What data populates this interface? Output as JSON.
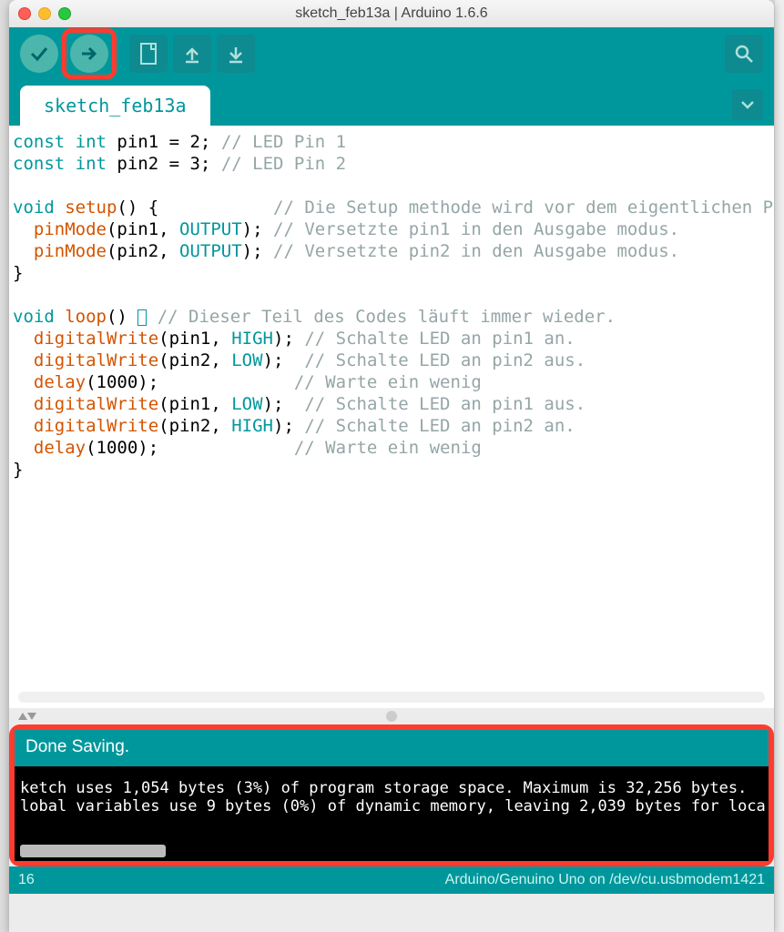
{
  "window": {
    "title": "sketch_feb13a | Arduino 1.6.6"
  },
  "toolbar": {
    "verify_icon": "checkmark-icon",
    "upload_icon": "arrow-right-icon",
    "new_icon": "file-icon",
    "open_icon": "arrow-up-icon",
    "save_icon": "arrow-down-icon",
    "serial_icon": "magnify-icon"
  },
  "tab": {
    "name": "sketch_feb13a"
  },
  "code": {
    "l1_a": "const",
    "l1_b": " int",
    "l1_c": " pin1 = 2; ",
    "l1_d": "// LED Pin 1",
    "l2_a": "const",
    "l2_b": " int",
    "l2_c": " pin2 = 3; ",
    "l2_d": "// LED Pin 2",
    "l4_a": "void",
    "l4_b": " setup",
    "l4_c": "() {           ",
    "l4_d": "// Die Setup methode wird vor dem eigentlichen Programm",
    "l5_a": "  pinMode",
    "l5_b": "(pin1, ",
    "l5_c": "OUTPUT",
    "l5_d": "); ",
    "l5_e": "// Versetzte pin1 in den Ausgabe modus.",
    "l6_a": "  pinMode",
    "l6_b": "(pin2, ",
    "l6_c": "OUTPUT",
    "l6_d": "); ",
    "l6_e": "// Versetzte pin2 in den Ausgabe modus.",
    "l7": "}",
    "l9_a": "void",
    "l9_b": " loop",
    "l9_c": "() ",
    "l9_d": " // Dieser Teil des Codes läuft immer wieder.",
    "l10_a": "  digitalWrite",
    "l10_b": "(pin1, ",
    "l10_c": "HIGH",
    "l10_d": "); ",
    "l10_e": "// Schalte LED an pin1 an.",
    "l11_a": "  digitalWrite",
    "l11_b": "(pin2, ",
    "l11_c": "LOW",
    "l11_d": ");  ",
    "l11_e": "// Schalte LED an pin2 aus.",
    "l12_a": "  delay",
    "l12_b": "(1000);             ",
    "l12_c": "// Warte ein wenig",
    "l13_a": "  digitalWrite",
    "l13_b": "(pin1, ",
    "l13_c": "LOW",
    "l13_d": ");  ",
    "l13_e": "// Schalte LED an pin1 aus.",
    "l14_a": "  digitalWrite",
    "l14_b": "(pin2, ",
    "l14_c": "HIGH",
    "l14_d": "); ",
    "l14_e": "// Schalte LED an pin2 an.",
    "l15_a": "  delay",
    "l15_b": "(1000);             ",
    "l15_c": "// Warte ein wenig",
    "l16": "}"
  },
  "status": {
    "message": "Done Saving."
  },
  "console": {
    "line1": "ketch uses 1,054 bytes (3%) of program storage space. Maximum is 32,256 bytes.",
    "line2": "lobal variables use 9 bytes (0%) of dynamic memory, leaving 2,039 bytes for loca"
  },
  "footer": {
    "line": "16",
    "board": "Arduino/Genuino Uno on /dev/cu.usbmodem1421"
  }
}
